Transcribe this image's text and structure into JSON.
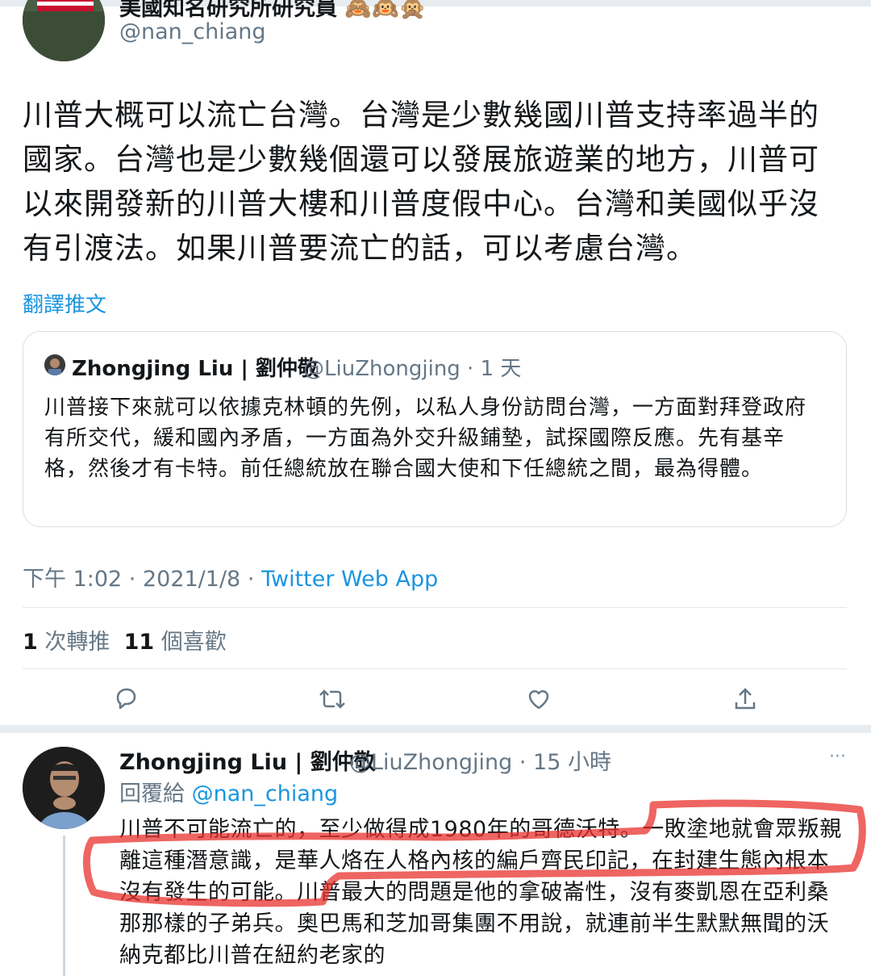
{
  "tweet": {
    "author_name": "美國知名研究所研究員 🙈🙉🙊",
    "author_handle": "@nan_chiang",
    "text": "川普大概可以流亡台灣。台灣是少數幾國川普支持率過半的國家。台灣也是少數幾個還可以發展旅遊業的地方，川普可以來開發新的川普大樓和川普度假中心。台灣和美國似乎沒有引渡法。如果川普要流亡的話，可以考慮台灣。",
    "translate_label": "翻譯推文",
    "time": "下午 1:02",
    "date": "2021/1/8",
    "source": "Twitter Web App",
    "retweet_count": "1",
    "retweet_label": "次轉推",
    "like_count": "11",
    "like_label": "個喜歡"
  },
  "quoted": {
    "name": "Zhongjing Liu | 劉仲敬",
    "handle": "@LiuZhongjing",
    "time": "1 天",
    "text": "川普接下來就可以依據克林頓的先例，以私人身份訪問台灣，一方面對拜登政府有所交代，緩和國內矛盾，一方面為外交升級鋪墊，試探國際反應。先有基辛格，然後才有卡特。前任總統放在聯合國大使和下任總統之間，最為得體。"
  },
  "actions": [
    {
      "icon": "reply-icon"
    },
    {
      "icon": "retweet-icon"
    },
    {
      "icon": "like-icon"
    },
    {
      "icon": "share-icon"
    }
  ],
  "reply": {
    "name": "Zhongjing Liu | 劉仲敬",
    "handle": "@LiuZhongjing",
    "time": "15 小時",
    "replying_prefix": "回覆給",
    "replying_handle": "@nan_chiang",
    "text": "川普不可能流亡的，至少做得成1980年的哥德沃特。一敗塗地就會眾叛親離這種潛意識，是華人烙在人格內核的編戶齊民印記，在封建生態內根本沒有發生的可能。川普最大的問題是他的拿破崙性，沒有麥凱恩在亞利桑那那樣的子弟兵。奧巴馬和芝加哥集團不用說，就連前半生默默無聞的沃納克都比川普在紐約老家的",
    "more_label": "···"
  },
  "colors": {
    "link": "#1b95e0",
    "muted": "#657786",
    "highlight_marker": "#e8322d"
  }
}
